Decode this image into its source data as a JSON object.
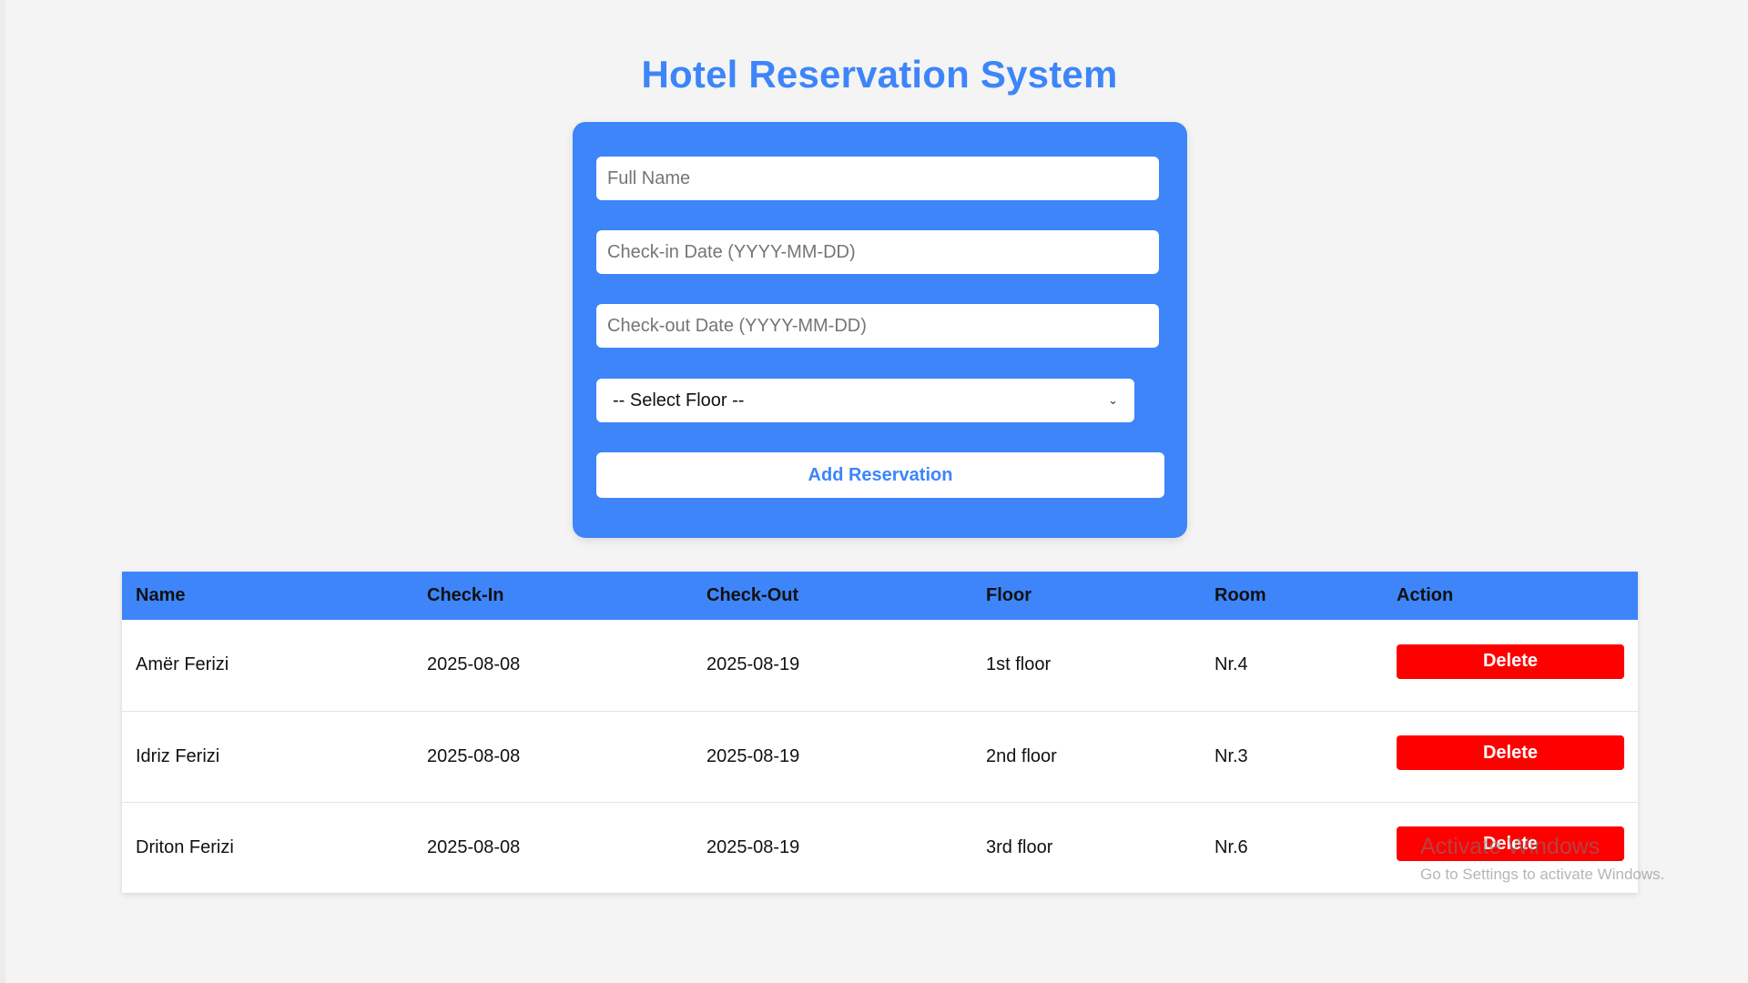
{
  "app": {
    "title": "Hotel Reservation System"
  },
  "form": {
    "full_name_placeholder": "Full Name",
    "checkin_placeholder": "Check-in Date (YYYY-MM-DD)",
    "checkout_placeholder": "Check-out Date (YYYY-MM-DD)",
    "floor_select_value": "-- Select Floor --",
    "add_button_label": "Add Reservation"
  },
  "table": {
    "headers": [
      "Name",
      "Check-In",
      "Check-Out",
      "Floor",
      "Room",
      "Action"
    ],
    "rows": [
      {
        "name": "Amër Ferizi",
        "checkin": "2025-08-08",
        "checkout": "2025-08-19",
        "floor": "1st floor",
        "room": "Nr.4",
        "action": "Delete"
      },
      {
        "name": "Idriz Ferizi",
        "checkin": "2025-08-08",
        "checkout": "2025-08-19",
        "floor": "2nd floor",
        "room": "Nr.3",
        "action": "Delete"
      },
      {
        "name": "Driton Ferizi",
        "checkin": "2025-08-08",
        "checkout": "2025-08-19",
        "floor": "3rd floor",
        "room": "Nr.6",
        "action": "Delete"
      }
    ]
  },
  "watermark": {
    "line1": "Activate Windows",
    "line2": "Go to Settings to activate Windows."
  },
  "colors": {
    "accent": "#3d85f9",
    "danger": "#ff0000",
    "background": "#f4f4f4"
  }
}
